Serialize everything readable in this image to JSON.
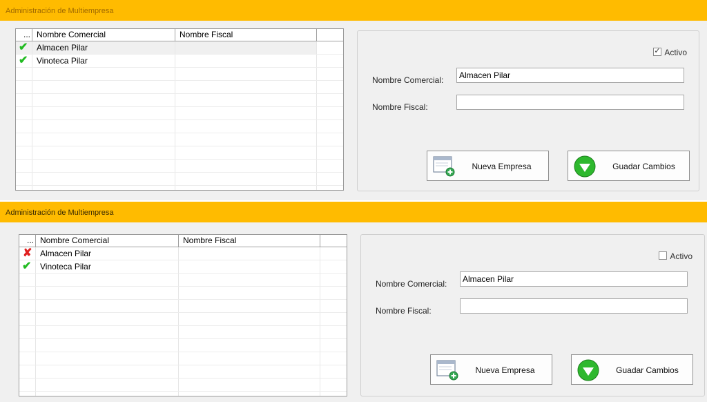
{
  "panels": [
    {
      "header_title": "Administración de Multiempresa",
      "grid": {
        "columns": [
          "...",
          "Nombre Comercial",
          "Nombre Fiscal"
        ],
        "rows": [
          {
            "status_icon": "check-icon",
            "nombre_comercial": "Almacen Pilar",
            "nombre_fiscal": ""
          },
          {
            "status_icon": "check-icon",
            "nombre_comercial": "Vinoteca Pilar",
            "nombre_fiscal": ""
          }
        ]
      },
      "form": {
        "activo_label": "Activo",
        "activo_checked": true,
        "nombre_comercial_label": "Nombre Comercial:",
        "nombre_comercial_value": "Almacen Pilar",
        "nombre_fiscal_label": "Nombre Fiscal:",
        "nombre_fiscal_value": "",
        "nueva_empresa_label": "Nueva Empresa",
        "guardar_cambios_label": "Guadar Cambios"
      }
    },
    {
      "header_title": "Administración de Multiempresa",
      "grid": {
        "columns": [
          "...",
          "Nombre Comercial",
          "Nombre Fiscal"
        ],
        "rows": [
          {
            "status_icon": "cross-icon",
            "nombre_comercial": "Almacen Pilar",
            "nombre_fiscal": ""
          },
          {
            "status_icon": "check-icon",
            "nombre_comercial": "Vinoteca Pilar",
            "nombre_fiscal": ""
          }
        ]
      },
      "form": {
        "activo_label": "Activo",
        "activo_checked": false,
        "nombre_comercial_label": "Nombre Comercial:",
        "nombre_comercial_value": "Almacen Pilar",
        "nombre_fiscal_label": "Nombre Fiscal:",
        "nombre_fiscal_value": "",
        "nueva_empresa_label": "Nueva Empresa",
        "guardar_cambios_label": "Guadar Cambios"
      }
    }
  ],
  "colors": {
    "header_bg": "#ffbb00",
    "check_green": "#22bb22",
    "cross_red": "#e02020"
  }
}
